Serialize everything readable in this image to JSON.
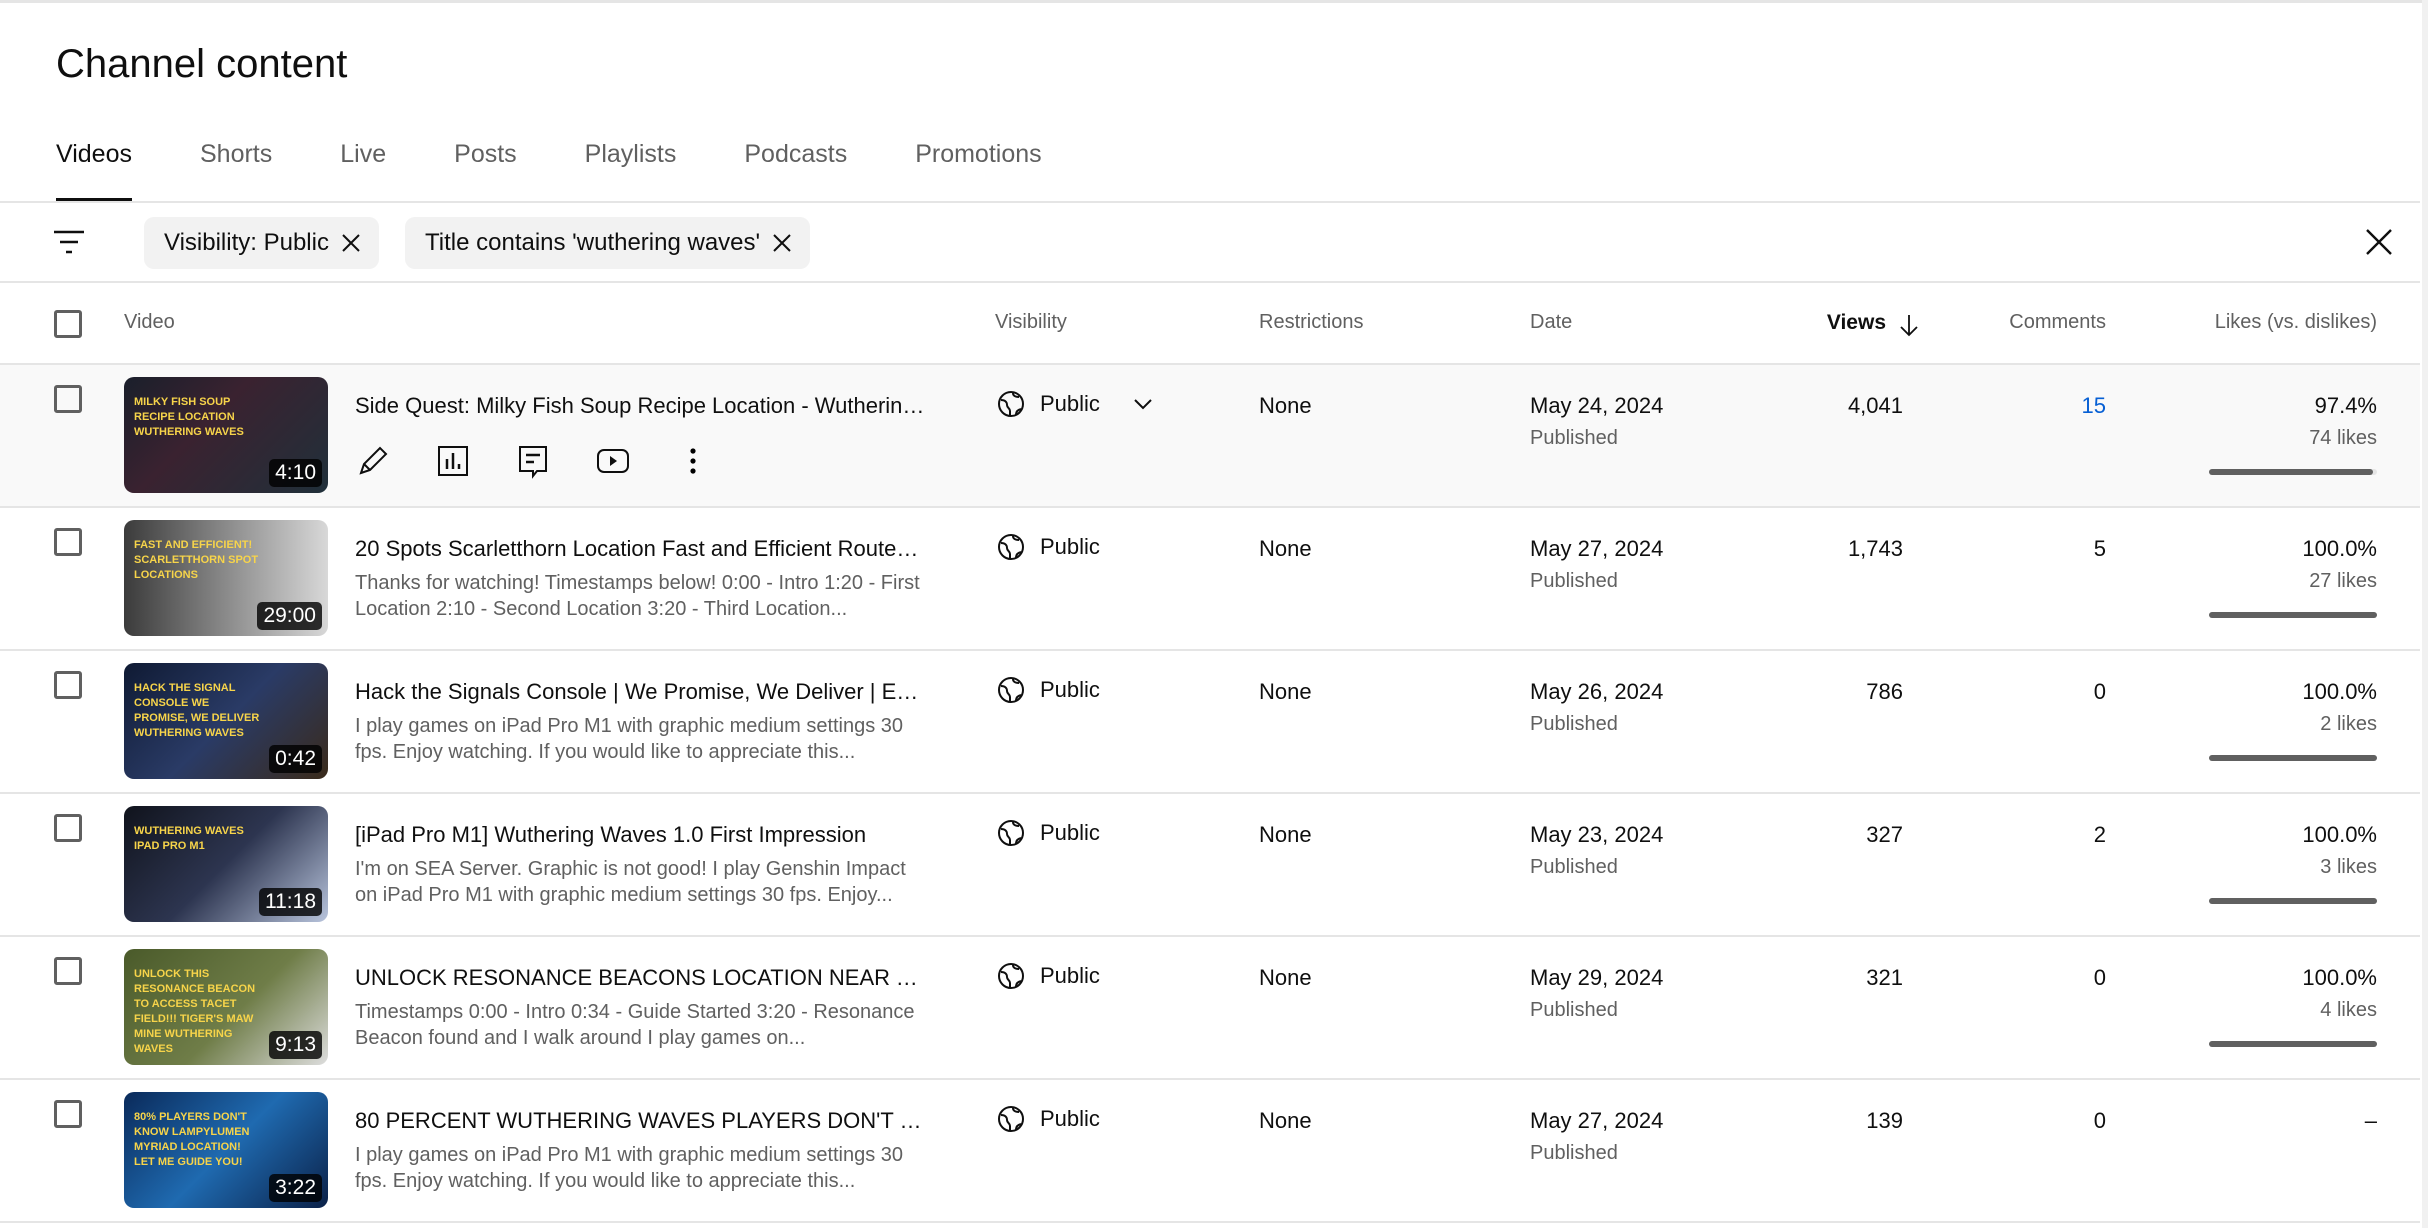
{
  "page_title": "Channel content",
  "tabs": [
    {
      "label": "Videos",
      "active": true
    },
    {
      "label": "Shorts"
    },
    {
      "label": "Live"
    },
    {
      "label": "Posts"
    },
    {
      "label": "Playlists"
    },
    {
      "label": "Podcasts"
    },
    {
      "label": "Promotions"
    }
  ],
  "filters": [
    "Visibility: Public",
    "Title contains 'wuthering waves'"
  ],
  "columns": {
    "video": "Video",
    "visibility": "Visibility",
    "restrictions": "Restrictions",
    "date": "Date",
    "views": "Views",
    "comments": "Comments",
    "likes": "Likes (vs. dislikes)"
  },
  "colors": {
    "link": "#065fd4",
    "bar": "#606060"
  },
  "rows": [
    {
      "title": "Side Quest: Milky Fish Soup Recipe Location - Wuthering ...",
      "description": "",
      "duration": "4:10",
      "thumb_text": "Milky Fish Soup Recipe Location Wuthering Waves",
      "visibility": "Public",
      "restrictions": "None",
      "date": "May 24, 2024",
      "status": "Published",
      "views": "4,041",
      "comments": "15",
      "likes_pct": "97.4%",
      "likes": "74 likes",
      "like_ratio": 0.974
    },
    {
      "title": "20 Spots Scarletthorn Location Fast and Efficient Routes...",
      "description": "Thanks for watching! Timestamps below! 0:00 - Intro 1:20 - First Location 2:10 - Second Location 3:20 - Third Location...",
      "duration": "29:00",
      "thumb_text": "Fast and Efficient! Scarletthorn Spot Locations",
      "visibility": "Public",
      "restrictions": "None",
      "date": "May 27, 2024",
      "status": "Published",
      "views": "1,743",
      "comments": "5",
      "likes_pct": "100.0%",
      "likes": "27 likes",
      "like_ratio": 1
    },
    {
      "title": "Hack the Signals Console | We Promise, We Deliver | Expl...",
      "description": "I play games on iPad Pro M1 with graphic medium settings 30 fps. Enjoy watching. If you would like to appreciate this...",
      "duration": "0:42",
      "thumb_text": "Hack the Signal Console We Promise, We Deliver Wuthering Waves",
      "visibility": "Public",
      "restrictions": "None",
      "date": "May 26, 2024",
      "status": "Published",
      "views": "786",
      "comments": "0",
      "likes_pct": "100.0%",
      "likes": "2 likes",
      "like_ratio": 1
    },
    {
      "title": "[iPad Pro M1] Wuthering Waves 1.0 First Impression",
      "description": "I'm on SEA Server. Graphic is not good! I play Genshin Impact on iPad Pro M1 with graphic medium settings 30 fps. Enjoy...",
      "duration": "11:18",
      "thumb_text": "Wuthering Waves iPad Pro M1",
      "visibility": "Public",
      "restrictions": "None",
      "date": "May 23, 2024",
      "status": "Published",
      "views": "327",
      "comments": "2",
      "likes_pct": "100.0%",
      "likes": "3 likes",
      "like_ratio": 1
    },
    {
      "title": "UNLOCK RESONANCE BEACONS LOCATION NEAR TIGE...",
      "description": "Timestamps 0:00 - Intro 0:34 - Guide Started 3:20 - Resonance Beacon found and I walk around I play games on...",
      "duration": "9:13",
      "thumb_text": "Unlock this Resonance Beacon to access Tacet Field!!! Tiger's Maw Mine Wuthering Waves",
      "visibility": "Public",
      "restrictions": "None",
      "date": "May 29, 2024",
      "status": "Published",
      "views": "321",
      "comments": "0",
      "likes_pct": "100.0%",
      "likes": "4 likes",
      "like_ratio": 1
    },
    {
      "title": "80 PERCENT WUTHERING WAVES PLAYERS DON'T KNO...",
      "description": "I play games on iPad Pro M1 with graphic medium settings 30 fps. Enjoy watching. If you would like to appreciate this...",
      "duration": "3:22",
      "thumb_text": "80% Players don't know Lampylumen Myriad location! Let me guide you!",
      "visibility": "Public",
      "restrictions": "None",
      "date": "May 27, 2024",
      "status": "Published",
      "views": "139",
      "comments": "0",
      "likes_pct": "–",
      "likes": "",
      "like_ratio": null
    }
  ]
}
